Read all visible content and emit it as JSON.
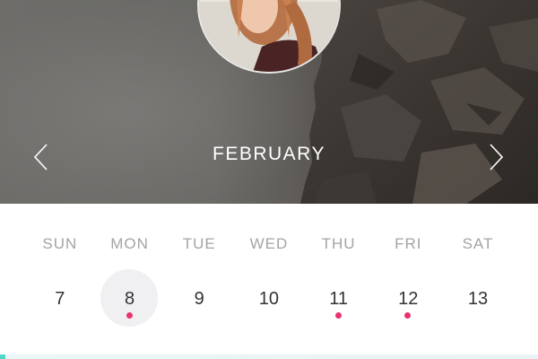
{
  "header": {
    "month": "FEBRUARY",
    "prev_icon": "chevron-left-icon",
    "next_icon": "chevron-right-icon",
    "avatar": "profile-photo"
  },
  "week": {
    "days": [
      {
        "weekday": "SUN",
        "date": "7",
        "selected": false,
        "event": false
      },
      {
        "weekday": "MON",
        "date": "8",
        "selected": true,
        "event": true
      },
      {
        "weekday": "TUE",
        "date": "9",
        "selected": false,
        "event": false
      },
      {
        "weekday": "WED",
        "date": "10",
        "selected": false,
        "event": false
      },
      {
        "weekday": "THU",
        "date": "11",
        "selected": false,
        "event": true
      },
      {
        "weekday": "FRI",
        "date": "12",
        "selected": false,
        "event": true
      },
      {
        "weekday": "SAT",
        "date": "13",
        "selected": false,
        "event": false
      }
    ]
  },
  "colors": {
    "event_dot": "#e8336e",
    "selected_bg": "#f0f0f2",
    "weekday_text": "#a4a4a4",
    "date_text": "#333333",
    "accent_line": "#52d6c8"
  }
}
